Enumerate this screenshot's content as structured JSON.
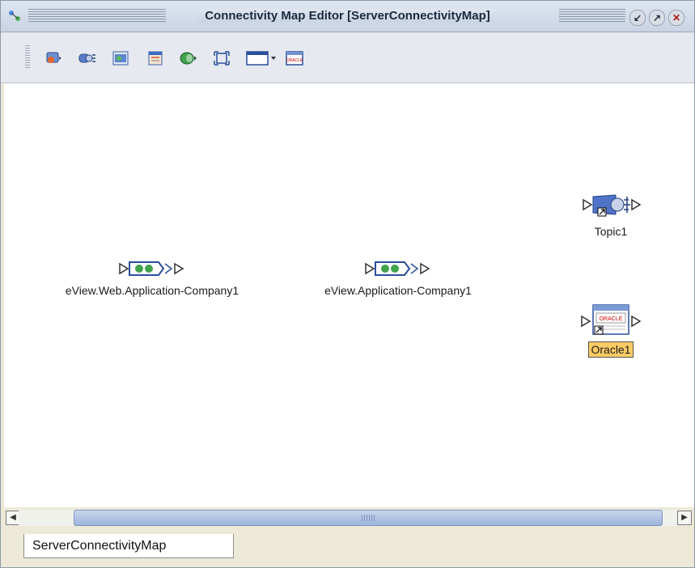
{
  "window": {
    "title": "Connectivity Map Editor [ServerConnectivityMap]",
    "buttons": [
      "minimize-restore",
      "maximize",
      "close"
    ]
  },
  "toolbar": {
    "tools": [
      "add-web-application-icon",
      "add-topic-icon",
      "add-service-icon",
      "add-form-icon",
      "add-queue-icon",
      "auto-layout-icon",
      "external-application-dropdown-icon",
      "oracle-external-icon"
    ]
  },
  "canvas": {
    "nodes": [
      {
        "id": "web-app",
        "label": "eView.Web.Application-Company1"
      },
      {
        "id": "app",
        "label": "eView.Application-Company1"
      },
      {
        "id": "topic",
        "label": "Topic1"
      },
      {
        "id": "oracle",
        "label": "Oracle1",
        "selected": true
      }
    ],
    "selection_color": "#ffcc66"
  },
  "tabs": [
    {
      "label": "ServerConnectivityMap",
      "active": true
    }
  ]
}
